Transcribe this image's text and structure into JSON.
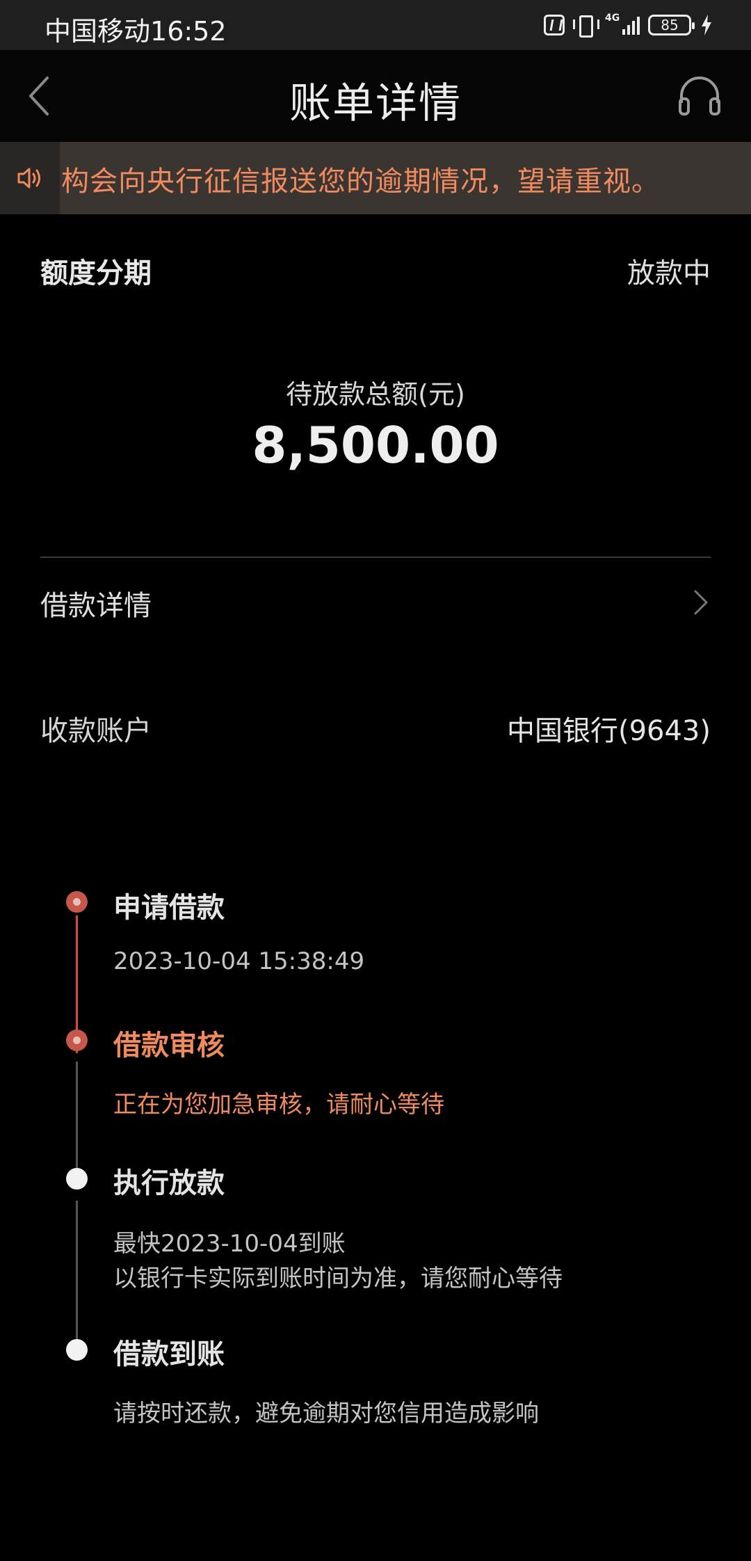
{
  "status_bar": {
    "carrier": "中国移动",
    "time": "16:52",
    "network": "4G",
    "battery": "85"
  },
  "header": {
    "title": "账单详情"
  },
  "notice": {
    "text": "构会向央行征信报送您的逾期情况，望请重视。"
  },
  "loan": {
    "product": "额度分期",
    "status": "放款中",
    "amount_label": "待放款总额(元)",
    "amount": "8,500.00",
    "detail_label": "借款详情",
    "account_label": "收款账户",
    "account_value": "中国银行(9643)"
  },
  "timeline": [
    {
      "title": "申请借款",
      "lines": [
        "2023-10-04 15:38:49"
      ]
    },
    {
      "title": "借款审核",
      "lines": [
        "正在为您加急审核，请耐心等待"
      ]
    },
    {
      "title": "执行放款",
      "lines": [
        "最快2023-10-04到账",
        "以银行卡实际到账时间为准，请您耐心等待"
      ]
    },
    {
      "title": "借款到账",
      "lines": [
        "请按时还款，避免逾期对您信用造成影响"
      ]
    }
  ],
  "colors": {
    "accent": "#f08a5f",
    "progress_red": "#d9473e",
    "background": "#000000"
  },
  "icons": [
    "back-icon",
    "headset-icon",
    "speaker-icon",
    "chevron-right-icon",
    "nfc-icon",
    "vibrate-icon",
    "signal-icon",
    "battery-icon",
    "charging-icon"
  ]
}
